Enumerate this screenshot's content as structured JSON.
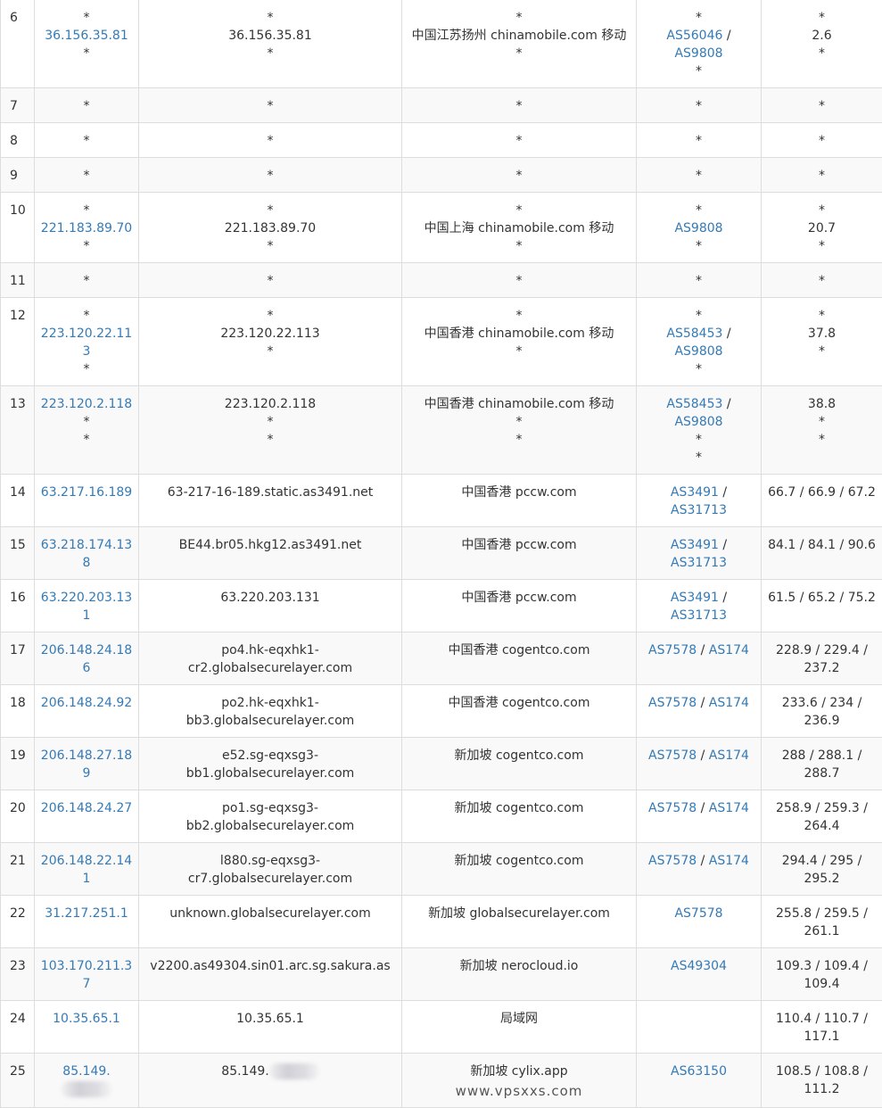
{
  "rows": [
    {
      "hop": "6",
      "ip": [
        "*",
        "36.156.35.81",
        "*"
      ],
      "host": [
        "*",
        "36.156.35.81",
        "*"
      ],
      "geo": [
        "*",
        "中国江苏扬州 chinamobile.com 移动",
        "*"
      ],
      "asn": [
        [
          "*"
        ],
        [
          "AS56046",
          "AS9808"
        ],
        [
          "*"
        ]
      ],
      "rtt": [
        "*",
        "2.6",
        "*"
      ]
    },
    {
      "hop": "7",
      "ip": [
        "*"
      ],
      "host": [
        "*"
      ],
      "geo": [
        "*"
      ],
      "asn": [
        [
          "*"
        ]
      ],
      "rtt": [
        "*"
      ]
    },
    {
      "hop": "8",
      "ip": [
        "*"
      ],
      "host": [
        "*"
      ],
      "geo": [
        "*"
      ],
      "asn": [
        [
          "*"
        ]
      ],
      "rtt": [
        "*"
      ]
    },
    {
      "hop": "9",
      "ip": [
        "*"
      ],
      "host": [
        "*"
      ],
      "geo": [
        "*"
      ],
      "asn": [
        [
          "*"
        ]
      ],
      "rtt": [
        "*"
      ]
    },
    {
      "hop": "10",
      "ip": [
        "*",
        "221.183.89.70",
        "*"
      ],
      "host": [
        "*",
        "221.183.89.70",
        "*"
      ],
      "geo": [
        "*",
        "中国上海 chinamobile.com 移动",
        "*"
      ],
      "asn": [
        [
          "*"
        ],
        [
          "AS9808"
        ],
        [
          "*"
        ]
      ],
      "rtt": [
        "*",
        "20.7",
        "*"
      ]
    },
    {
      "hop": "11",
      "ip": [
        "*"
      ],
      "host": [
        "*"
      ],
      "geo": [
        "*"
      ],
      "asn": [
        [
          "*"
        ]
      ],
      "rtt": [
        "*"
      ]
    },
    {
      "hop": "12",
      "ip": [
        "*",
        "223.120.22.113",
        "*"
      ],
      "host": [
        "*",
        "223.120.22.113",
        "*"
      ],
      "geo": [
        "*",
        "中国香港 chinamobile.com 移动",
        "*"
      ],
      "asn": [
        [
          "*"
        ],
        [
          "AS58453",
          "AS9808"
        ],
        [
          "*"
        ]
      ],
      "rtt": [
        "*",
        "37.8",
        "*"
      ]
    },
    {
      "hop": "13",
      "ip": [
        "223.120.2.118",
        "*",
        "*"
      ],
      "host": [
        "223.120.2.118",
        "*",
        "*"
      ],
      "geo": [
        "中国香港 chinamobile.com 移动",
        "*",
        "*"
      ],
      "asn": [
        [
          "AS58453",
          "AS9808"
        ],
        [
          "*"
        ],
        [
          "*"
        ]
      ],
      "rtt": [
        "38.8",
        "*",
        "*"
      ]
    },
    {
      "hop": "14",
      "ip": [
        "63.217.16.189"
      ],
      "host": [
        "63-217-16-189.static.as3491.net"
      ],
      "geo": [
        "中国香港 pccw.com"
      ],
      "asn": [
        [
          "AS3491",
          "AS31713"
        ]
      ],
      "rtt": [
        "66.7 / 66.9 / 67.2"
      ]
    },
    {
      "hop": "15",
      "ip": [
        "63.218.174.138"
      ],
      "host": [
        "BE44.br05.hkg12.as3491.net"
      ],
      "geo": [
        "中国香港 pccw.com"
      ],
      "asn": [
        [
          "AS3491",
          "AS31713"
        ]
      ],
      "rtt": [
        "84.1 / 84.1 / 90.6"
      ]
    },
    {
      "hop": "16",
      "ip": [
        "63.220.203.131"
      ],
      "host": [
        "63.220.203.131"
      ],
      "geo": [
        "中国香港 pccw.com"
      ],
      "asn": [
        [
          "AS3491",
          "AS31713"
        ]
      ],
      "rtt": [
        "61.5 / 65.2 / 75.2"
      ]
    },
    {
      "hop": "17",
      "ip": [
        "206.148.24.186"
      ],
      "host": [
        "po4.hk-eqxhk1-cr2.globalsecurelayer.com"
      ],
      "geo": [
        "中国香港 cogentco.com"
      ],
      "asn": [
        [
          "AS7578",
          "AS174"
        ]
      ],
      "rtt": [
        "228.9 / 229.4 / 237.2"
      ]
    },
    {
      "hop": "18",
      "ip": [
        "206.148.24.92"
      ],
      "host": [
        "po2.hk-eqxhk1-bb3.globalsecurelayer.com"
      ],
      "geo": [
        "中国香港 cogentco.com"
      ],
      "asn": [
        [
          "AS7578",
          "AS174"
        ]
      ],
      "rtt": [
        "233.6 / 234 / 236.9"
      ]
    },
    {
      "hop": "19",
      "ip": [
        "206.148.27.189"
      ],
      "host": [
        "e52.sg-eqxsg3-bb1.globalsecurelayer.com"
      ],
      "geo": [
        "新加坡 cogentco.com"
      ],
      "asn": [
        [
          "AS7578",
          "AS174"
        ]
      ],
      "rtt": [
        "288 / 288.1 / 288.7"
      ]
    },
    {
      "hop": "20",
      "ip": [
        "206.148.24.27"
      ],
      "host": [
        "po1.sg-eqxsg3-bb2.globalsecurelayer.com"
      ],
      "geo": [
        "新加坡 cogentco.com"
      ],
      "asn": [
        [
          "AS7578",
          "AS174"
        ]
      ],
      "rtt": [
        "258.9 / 259.3 / 264.4"
      ]
    },
    {
      "hop": "21",
      "ip": [
        "206.148.22.141"
      ],
      "host": [
        "l880.sg-eqxsg3-cr7.globalsecurelayer.com"
      ],
      "geo": [
        "新加坡 cogentco.com"
      ],
      "asn": [
        [
          "AS7578",
          "AS174"
        ]
      ],
      "rtt": [
        "294.4 / 295 / 295.2"
      ]
    },
    {
      "hop": "22",
      "ip": [
        "31.217.251.1"
      ],
      "host": [
        "unknown.globalsecurelayer.com"
      ],
      "geo": [
        "新加坡 globalsecurelayer.com"
      ],
      "asn": [
        [
          "AS7578"
        ]
      ],
      "rtt": [
        "255.8 / 259.5 / 261.1"
      ]
    },
    {
      "hop": "23",
      "ip": [
        "103.170.211.37"
      ],
      "host": [
        "v2200.as49304.sin01.arc.sg.sakura.as"
      ],
      "geo": [
        "新加坡 nerocloud.io"
      ],
      "asn": [
        [
          "AS49304"
        ]
      ],
      "rtt": [
        "109.3 / 109.4 / 109.4"
      ]
    },
    {
      "hop": "24",
      "ip": [
        "10.35.65.1"
      ],
      "host": [
        "10.35.65.1"
      ],
      "geo": [
        "局域网"
      ],
      "asn": [
        []
      ],
      "rtt": [
        "110.4 / 110.7 / 117.1"
      ]
    },
    {
      "hop": "25",
      "ip": [
        "85.149."
      ],
      "host": [
        "85.149."
      ],
      "geo": [
        "新加坡 cylix.app"
      ],
      "asn": [
        [
          "AS63150"
        ]
      ],
      "rtt": [
        "108.5 / 108.8 / 111.2"
      ],
      "masked": true
    }
  ],
  "watermark": "www.vpsxxs.com"
}
